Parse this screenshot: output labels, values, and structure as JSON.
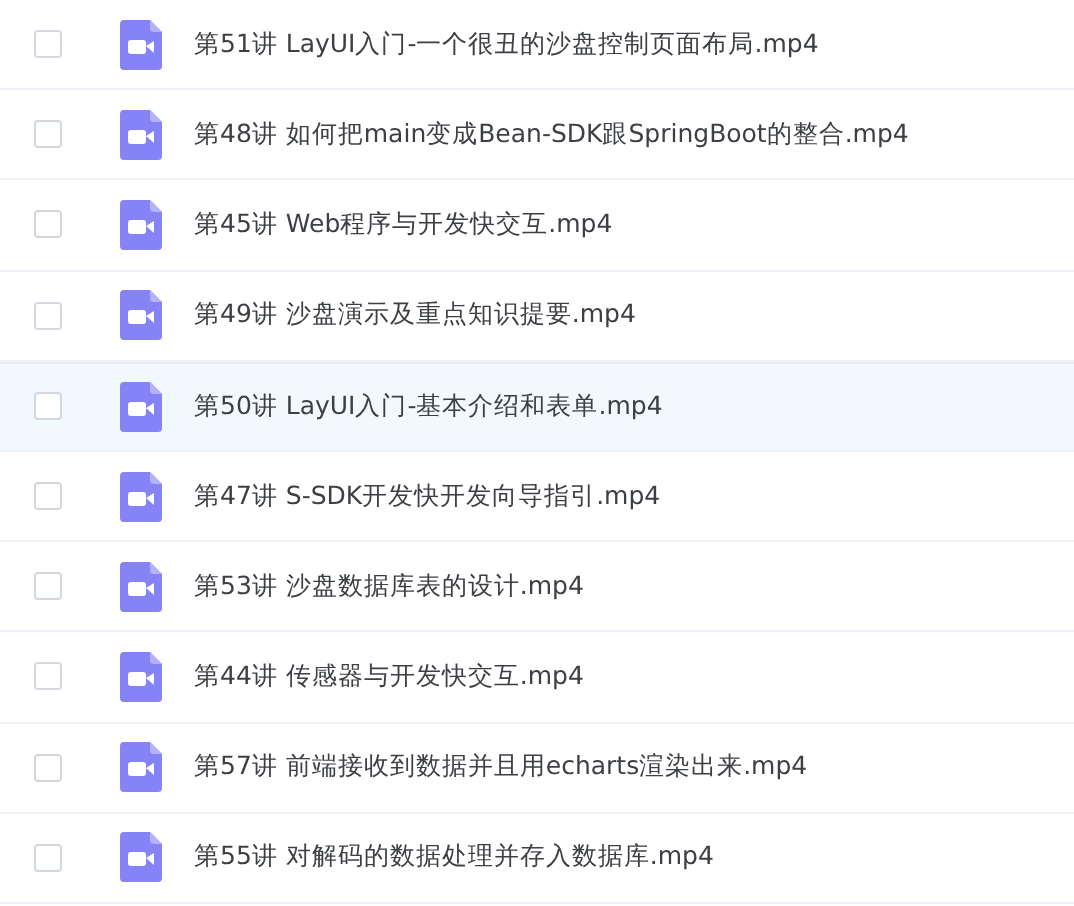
{
  "files": [
    {
      "name": "第51讲 LayUI入门-一个很丑的沙盘控制页面布局.mp4",
      "checked": false,
      "highlighted": false
    },
    {
      "name": "第48讲 如何把main变成Bean-SDK跟SpringBoot的整合.mp4",
      "checked": false,
      "highlighted": false
    },
    {
      "name": "第45讲 Web程序与开发快交互.mp4",
      "checked": false,
      "highlighted": false
    },
    {
      "name": "第49讲 沙盘演示及重点知识提要.mp4",
      "checked": false,
      "highlighted": false
    },
    {
      "name": "第50讲 LayUI入门-基本介绍和表单.mp4",
      "checked": false,
      "highlighted": true
    },
    {
      "name": "第47讲 S-SDK开发快开发向导指引.mp4",
      "checked": false,
      "highlighted": false
    },
    {
      "name": "第53讲 沙盘数据库表的设计.mp4",
      "checked": false,
      "highlighted": false
    },
    {
      "name": "第44讲 传感器与开发快交互.mp4",
      "checked": false,
      "highlighted": false
    },
    {
      "name": "第57讲 前端接收到数据并且用echarts渲染出来.mp4",
      "checked": false,
      "highlighted": false
    },
    {
      "name": "第55讲 对解码的数据处理并存入数据库.mp4",
      "checked": false,
      "highlighted": false
    }
  ]
}
